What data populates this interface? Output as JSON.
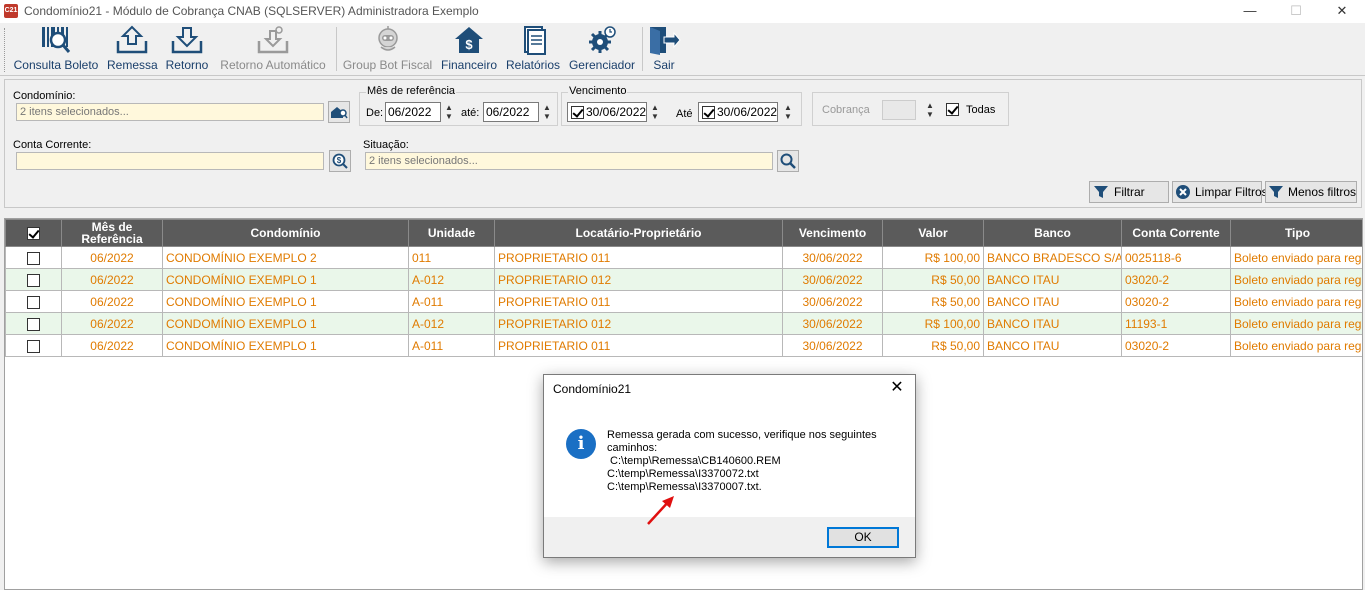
{
  "window": {
    "title": "Condomínio21 - Módulo de Cobrança CNAB (SQLSERVER)  Administradora Exemplo",
    "icon_text": "C21",
    "minimize": "—",
    "maximize": "☐",
    "close": "✕"
  },
  "toolbar": {
    "items": [
      {
        "label": "Consulta Boleto",
        "icon": "barcode-search-icon",
        "enabled": true
      },
      {
        "label": "Remessa",
        "icon": "upload-tray-icon",
        "enabled": true
      },
      {
        "label": "Retorno",
        "icon": "download-tray-icon",
        "enabled": true
      },
      {
        "label": "Retorno Automático",
        "icon": "auto-download-icon",
        "enabled": false
      },
      {
        "label": "Group Bot Fiscal",
        "icon": "robot-icon",
        "enabled": false
      },
      {
        "label": "Financeiro",
        "icon": "house-money-icon",
        "enabled": true
      },
      {
        "label": "Relatórios",
        "icon": "report-icon",
        "enabled": true
      },
      {
        "label": "Gerenciador",
        "icon": "gear-clock-icon",
        "enabled": true
      },
      {
        "label": "Sair",
        "icon": "exit-door-icon",
        "enabled": true
      }
    ]
  },
  "filters": {
    "condominio_label": "Condomínio:",
    "condominio_value": "2 itens selecionados...",
    "mes_ref_title": "Mês de referência",
    "mes_de_label": "De:",
    "mes_de_value": "06/2022",
    "mes_ate_label": "até:",
    "mes_ate_value": "06/2022",
    "vencimento_title": "Vencimento",
    "venc_de_value": "30/06/2022",
    "venc_ate_label": "Até",
    "venc_ate_value": "30/06/2022",
    "cobranca_label": "Cobrança",
    "todas_label": "Todas",
    "conta_label": "Conta Corrente:",
    "conta_value": "",
    "situacao_label": "Situação:",
    "situacao_value": "2 itens selecionados...",
    "btn_filtrar": "Filtrar",
    "btn_limpar": "Limpar Filtros",
    "btn_menos": "Menos filtros"
  },
  "grid": {
    "headers": {
      "mes": "Mês de Referência",
      "condominio": "Condomínio",
      "unidade": "Unidade",
      "locatario": "Locatário-Proprietário",
      "vencimento": "Vencimento",
      "valor": "Valor",
      "banco": "Banco",
      "conta": "Conta Corrente",
      "tipo": "Tipo"
    },
    "rows": [
      {
        "mes": "06/2022",
        "condominio": "CONDOMÍNIO EXEMPLO 2",
        "unidade": "011",
        "locatario": "PROPRIETARIO 011",
        "vencimento": "30/06/2022",
        "valor": "R$ 100,00",
        "banco": "BANCO BRADESCO S/A",
        "conta": "0025118-6",
        "tipo": "Boleto enviado para regi..."
      },
      {
        "mes": "06/2022",
        "condominio": "CONDOMÍNIO EXEMPLO 1",
        "unidade": "A-012",
        "locatario": "PROPRIETARIO 012",
        "vencimento": "30/06/2022",
        "valor": "R$ 50,00",
        "banco": "BANCO ITAU",
        "conta": "03020-2",
        "tipo": "Boleto enviado para regi..."
      },
      {
        "mes": "06/2022",
        "condominio": "CONDOMÍNIO EXEMPLO 1",
        "unidade": "A-011",
        "locatario": "PROPRIETARIO 011",
        "vencimento": "30/06/2022",
        "valor": "R$ 50,00",
        "banco": "BANCO ITAU",
        "conta": "03020-2",
        "tipo": "Boleto enviado para regi..."
      },
      {
        "mes": "06/2022",
        "condominio": "CONDOMÍNIO EXEMPLO 1",
        "unidade": "A-012",
        "locatario": "PROPRIETARIO 012",
        "vencimento": "30/06/2022",
        "valor": "R$ 100,00",
        "banco": "BANCO ITAU",
        "conta": "11193-1",
        "tipo": "Boleto enviado para regi..."
      },
      {
        "mes": "06/2022",
        "condominio": "CONDOMÍNIO EXEMPLO 1",
        "unidade": "A-011",
        "locatario": "PROPRIETARIO 011",
        "vencimento": "30/06/2022",
        "valor": "R$ 50,00",
        "banco": "BANCO ITAU",
        "conta": "03020-2",
        "tipo": "Boleto enviado para regi..."
      }
    ]
  },
  "dialog": {
    "title": "Condomínio21",
    "close": "✕",
    "info_glyph": "i",
    "message_lines": [
      "Remessa gerada com sucesso, verifique nos seguintes",
      "caminhos:",
      " C:\\temp\\Remessa\\CB140600.REM",
      "C:\\temp\\Remessa\\I3370072.txt",
      "C:\\temp\\Remessa\\I3370007.txt."
    ],
    "ok_label": "OK"
  },
  "colors": {
    "row_text": "#e07b00",
    "header_bg": "#5b5b5b",
    "alt_row": "#eaf7ea",
    "field_bg": "#fff8dc",
    "toolbar_text": "#1a3f6b",
    "annotation_arrow": "#e01010"
  }
}
